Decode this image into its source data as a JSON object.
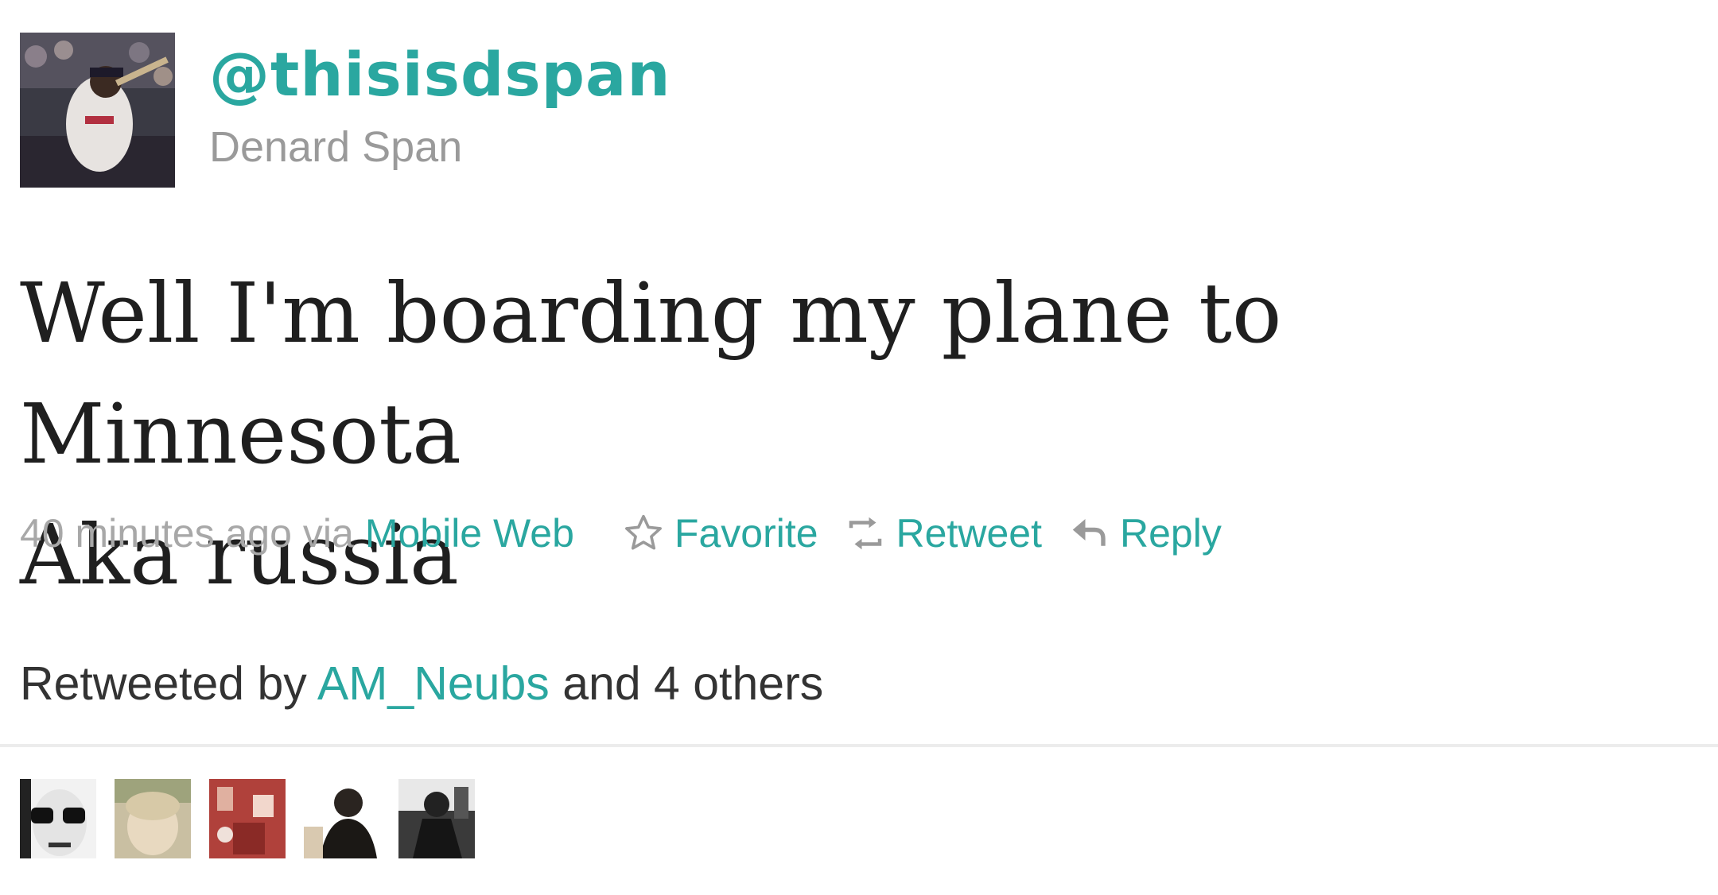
{
  "tweet": {
    "handle": "@thisisdspan",
    "name": "Denard Span",
    "text_line1": "Well I'm boarding my plane to Minnesota",
    "text_line2": "Aka russia",
    "meta": {
      "time": "40 minutes ago",
      "via": "via",
      "source": "Mobile Web",
      "favorite": "Favorite",
      "retweet": "Retweet",
      "reply": "Reply"
    },
    "retweeted_by": {
      "prefix": "Retweeted by",
      "user": "AM_Neubs",
      "suffix": "and 4 others"
    }
  },
  "colors": {
    "link": "#2aa7a0",
    "muted": "#a8a8a8",
    "text": "#1f1f1f"
  },
  "icons": {
    "favorite": "star-outline-icon",
    "retweet": "retweet-arrows-icon",
    "reply": "reply-arrow-icon"
  }
}
